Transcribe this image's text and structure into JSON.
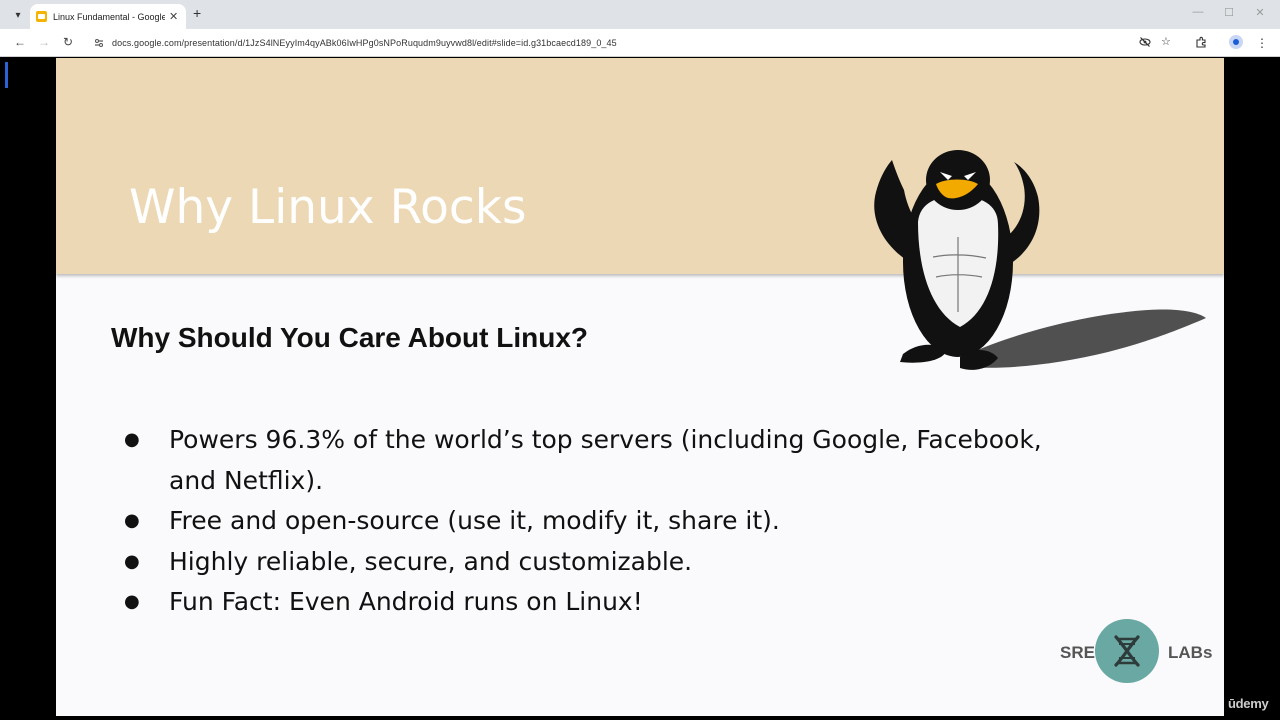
{
  "browser": {
    "tab_menu_icon": "chevron-down-icon",
    "tab_title": "Linux Fundamental - Google Sl",
    "tab_close": "✕",
    "new_tab": "+",
    "window_controls": {
      "minimize": "—",
      "maximize": "☐",
      "close": "✕"
    },
    "nav": {
      "back": "←",
      "forward": "→",
      "reload": "↻"
    },
    "url": "docs.google.com/presentation/d/1JzS4lNEyyIm4qyABk06IwHPg0sNPoRuqudm9uyvwd8l/edit#slide=id.g31bcaecd189_0_45",
    "icons": [
      "site-info-icon",
      "eye-off-icon",
      "star-icon",
      "extensions-icon",
      "profile-icon",
      "kebab-menu-icon"
    ]
  },
  "slide": {
    "title": "Why Linux Rocks",
    "subtitle": "Why Should You Care About Linux?",
    "bullets": [
      "Powers 96.3% of the world’s top servers (including Google, Facebook, and Netflix).",
      "Free and open-source (use it, modify it, share it).",
      "Highly reliable, secure, and customizable.",
      "Fun Fact: Even Android runs on Linux!"
    ],
    "logo": {
      "left": "SRE",
      "right": "LABs"
    },
    "header_color": "#ecd8b5",
    "logo_color": "#6aa8a3"
  },
  "watermark": "ūdemy"
}
